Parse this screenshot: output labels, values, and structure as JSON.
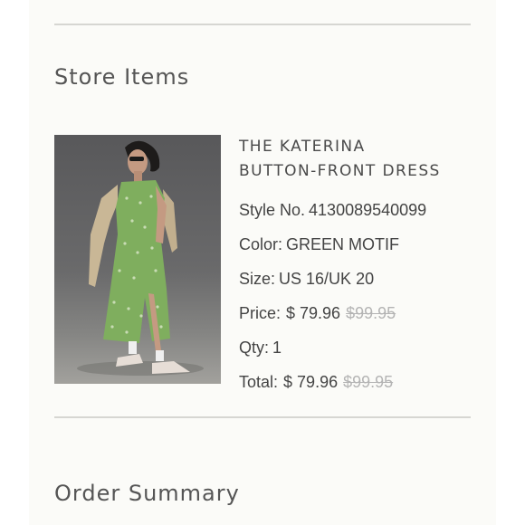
{
  "sections": {
    "store_items_title": "Store Items",
    "order_summary_title": "Order Summary"
  },
  "item": {
    "name_line1": "THE KATERINA",
    "name_line2": "BUTTON-FRONT DRESS",
    "style_label": "Style No.",
    "style_value": "4130089540099",
    "color_label": "Color:",
    "color_value": "GREEN MOTIF",
    "size_label": "Size:",
    "size_value": "US 16/UK 20",
    "price_label": "Price:",
    "price_now": "$ 79.96",
    "price_was": "$99.95",
    "qty_label": "Qty:",
    "qty_value": "1",
    "total_label": "Total:",
    "total_now": "$ 79.96",
    "total_was": "$99.95"
  },
  "colors": {
    "page_background": "#fbfbf8",
    "text": "#444444",
    "strikethrough_price": "#b4b4b4",
    "divider": "#d6d6d2",
    "dress_green": "#7fae5e"
  }
}
